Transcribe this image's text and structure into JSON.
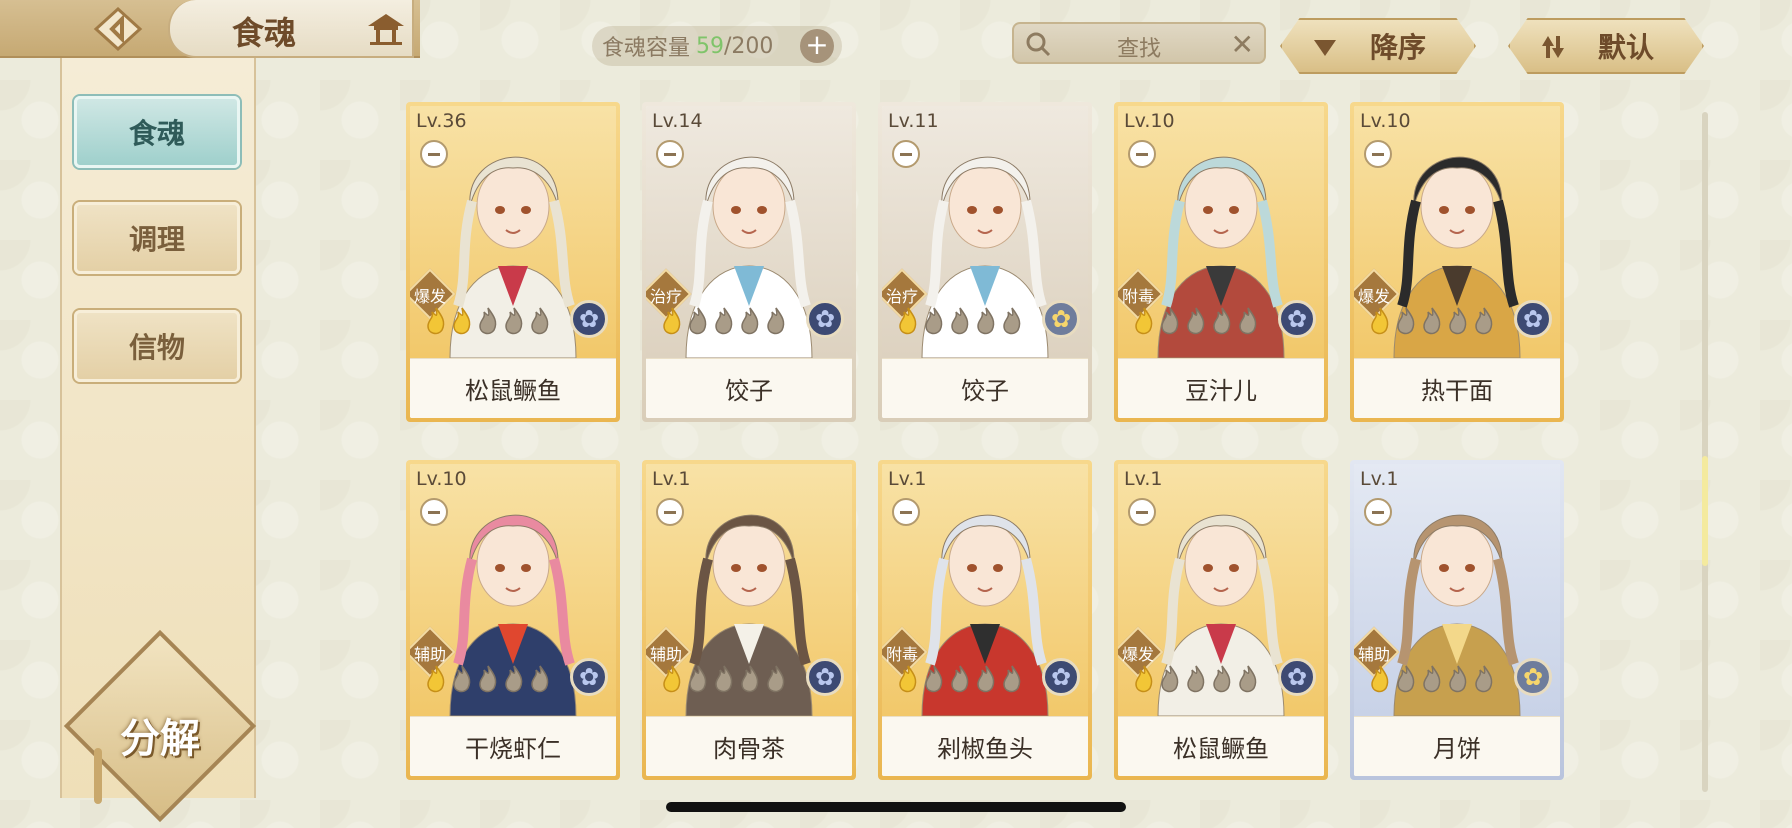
{
  "header": {
    "title": "食魂",
    "back_icon": "back-arrow-icon",
    "home_icon": "pavilion-icon"
  },
  "capacity": {
    "label": "食魂容量",
    "current": "59",
    "max": "/200",
    "add": "+"
  },
  "search": {
    "placeholder": "查找",
    "clear": "✕"
  },
  "sort": {
    "order_label": "降序",
    "mode_label": "默认"
  },
  "sidebar": {
    "items": [
      {
        "label": "食魂",
        "active": true
      },
      {
        "label": "调理",
        "active": false
      },
      {
        "label": "信物",
        "active": false
      }
    ],
    "decompose_label": "分解"
  },
  "cards": [
    {
      "level": "Lv.36",
      "name": "松鼠鳜鱼",
      "type": "爆发",
      "stars": 2,
      "frame": "gold",
      "element": "blue",
      "hair": "#e9e3d2",
      "outfit": "#f2efe6",
      "accent": "#c93a4a"
    },
    {
      "level": "Lv.14",
      "name": "饺子",
      "type": "治疗",
      "stars": 1,
      "frame": "white",
      "element": "blue",
      "hair": "#f3f1ec",
      "outfit": "#ffffff",
      "accent": "#7fbad6"
    },
    {
      "level": "Lv.11",
      "name": "饺子",
      "type": "治疗",
      "stars": 1,
      "frame": "white",
      "element": "gold",
      "hair": "#f3f1ec",
      "outfit": "#ffffff",
      "accent": "#7fbad6"
    },
    {
      "level": "Lv.10",
      "name": "豆汁儿",
      "type": "附毒",
      "stars": 1,
      "frame": "gold",
      "element": "blue",
      "hair": "#bcd9da",
      "outfit": "#b34a3d",
      "accent": "#3a3a3a"
    },
    {
      "level": "Lv.10",
      "name": "热干面",
      "type": "爆发",
      "stars": 1,
      "frame": "gold",
      "element": "blue",
      "hair": "#2b2b2b",
      "outfit": "#d9a646",
      "accent": "#4a3b2d"
    },
    {
      "level": "Lv.10",
      "name": "干烧虾仁",
      "type": "辅助",
      "stars": 1,
      "frame": "gold",
      "element": "blue",
      "hair": "#e98aa0",
      "outfit": "#2f3f6b",
      "accent": "#e0472f"
    },
    {
      "level": "Lv.1",
      "name": "肉骨茶",
      "type": "辅助",
      "stars": 1,
      "frame": "gold",
      "element": "blue",
      "hair": "#6b5544",
      "outfit": "#6e5e52",
      "accent": "#f4f1e8"
    },
    {
      "level": "Lv.1",
      "name": "剁椒鱼头",
      "type": "附毒",
      "stars": 1,
      "frame": "gold",
      "element": "blue",
      "hair": "#dfe3ea",
      "outfit": "#c8372d",
      "accent": "#2f2f2f"
    },
    {
      "level": "Lv.1",
      "name": "松鼠鳜鱼",
      "type": "爆发",
      "stars": 1,
      "frame": "gold",
      "element": "blue",
      "hair": "#e9e3d2",
      "outfit": "#f2efe6",
      "accent": "#c93a4a"
    },
    {
      "level": "Lv.1",
      "name": "月饼",
      "type": "辅助",
      "stars": 1,
      "frame": "blue",
      "element": "gold",
      "hair": "#b69470",
      "outfit": "#c7a04e",
      "accent": "#f3d88a"
    }
  ]
}
